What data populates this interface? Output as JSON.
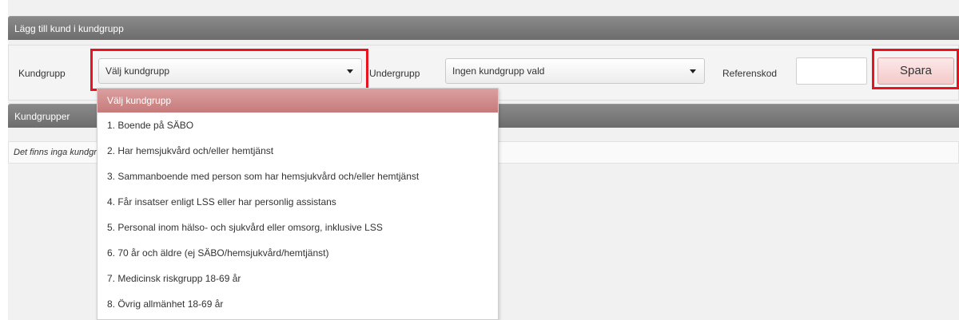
{
  "panel": {
    "title": "Lägg till kund i kundgrupp"
  },
  "form": {
    "kundgrupp_label": "Kundgrupp",
    "kundgrupp_value": "Välj kundgrupp",
    "undergrupp_label": "Undergrupp",
    "undergrupp_value": "Ingen kundgrupp vald",
    "referenskod_label": "Referenskod",
    "referenskod_value": "",
    "save_label": "Spara"
  },
  "groups": {
    "title": "Kundgrupper",
    "empty_text": "Det finns inga kundgrupper"
  },
  "dropdown": {
    "options": [
      "Välj kundgrupp",
      "1. Boende på SÄBO",
      "2. Har hemsjukvård och/eller hemtjänst",
      "3. Sammanboende med person som har hemsjukvård och/eller hemtjänst",
      "4. Får insatser enligt LSS eller har personlig assistans",
      "5. Personal inom hälso- och sjukvård eller omsorg, inklusive LSS",
      "6. 70 år och äldre (ej SÄBO/hemsjukvård/hemtjänst)",
      "7. Medicinsk riskgrupp 18-69 år",
      "8. Övrig allmänhet 18-69 år"
    ],
    "selected": "Välj kundgrupp"
  },
  "colors": {
    "header_bar": "#7b7b7b",
    "highlight": "#e8131f",
    "selected_option": "#d18c8c",
    "save_button": "#f7d6d6"
  }
}
